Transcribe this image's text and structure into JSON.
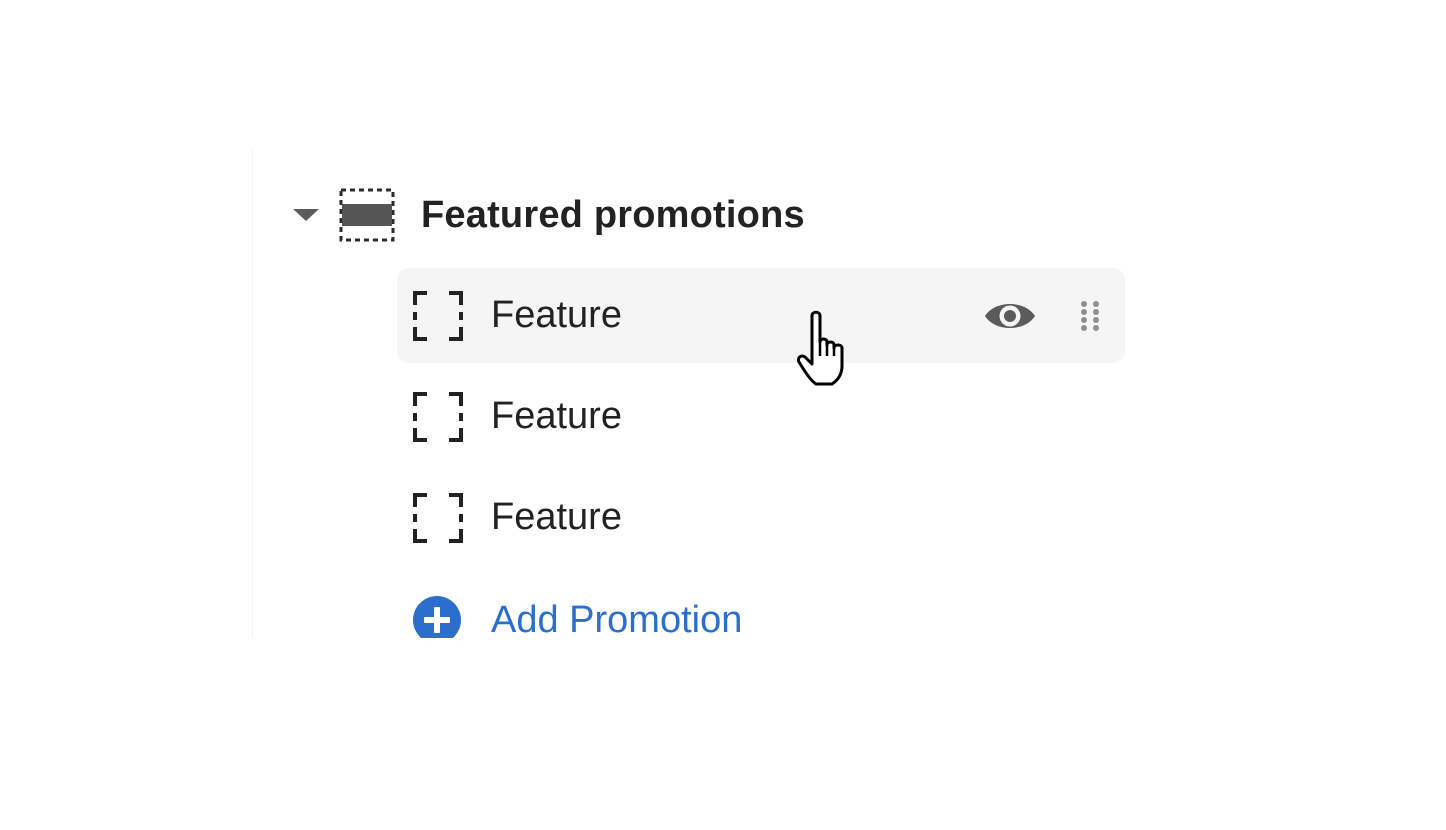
{
  "section": {
    "title": "Featured promotions",
    "expanded": true,
    "icon": "section-dashed-rect-icon"
  },
  "blocks": [
    {
      "label": "Feature",
      "icon": "block-dashed-frame-icon",
      "hovered": true
    },
    {
      "label": "Feature",
      "icon": "block-dashed-frame-icon",
      "hovered": false
    },
    {
      "label": "Feature",
      "icon": "block-dashed-frame-icon",
      "hovered": false
    }
  ],
  "block_actions": {
    "visibility_icon": "eye-icon",
    "drag_icon": "drag-handle-icon"
  },
  "add_block": {
    "label": "Add Promotion",
    "icon": "plus-circle-icon"
  },
  "cursor": "hand-pointer-cursor",
  "colors": {
    "link": "#2c6ecb",
    "text": "#202223",
    "hover_background": "#f5f5f5",
    "icon": "#5b5b5b"
  }
}
